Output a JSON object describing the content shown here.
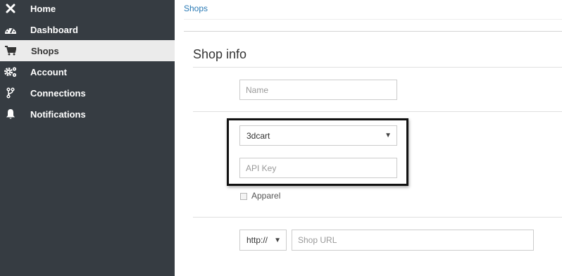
{
  "sidebar": {
    "items": [
      {
        "label": "Home",
        "icon": "close-icon"
      },
      {
        "label": "Dashboard",
        "icon": "dashboard-icon"
      },
      {
        "label": "Shops",
        "icon": "cart-icon",
        "active": true
      },
      {
        "label": "Account",
        "icon": "gears-icon"
      },
      {
        "label": "Connections",
        "icon": "connections-icon"
      },
      {
        "label": "Notifications",
        "icon": "bell-icon"
      }
    ]
  },
  "breadcrumb": "Shops",
  "page_title": "Shop info",
  "form": {
    "name_placeholder": "Name",
    "platform_selected": "3dcart",
    "api_key_placeholder": "API Key",
    "apparel_label": "Apparel",
    "protocol_selected": "http://",
    "shop_url_placeholder": "Shop URL"
  },
  "colors": {
    "sidebar_bg": "#363c42",
    "active_item_bg": "#ebebeb",
    "link": "#2a7ab5"
  }
}
